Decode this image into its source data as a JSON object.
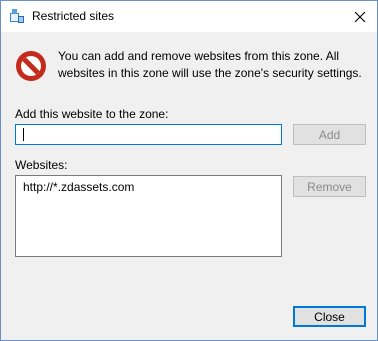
{
  "window": {
    "title": "Restricted sites"
  },
  "info": {
    "text": "You can add and remove websites from this zone. All websites in this zone will use the zone's security settings."
  },
  "add_site": {
    "label": "Add this website to the zone:",
    "value": "",
    "add_button": "Add"
  },
  "websites": {
    "label": "Websites:",
    "items": [
      "http://*.zdassets.com"
    ],
    "remove_button": "Remove"
  },
  "footer": {
    "close_button": "Close"
  },
  "colors": {
    "accent": "#0078d7",
    "warning_red": "#c42b1c",
    "disabled_text": "#8a8a8a"
  },
  "icons": {
    "app": "internet-options-icon",
    "warning": "restricted-no-entry-icon",
    "close": "close-icon"
  }
}
